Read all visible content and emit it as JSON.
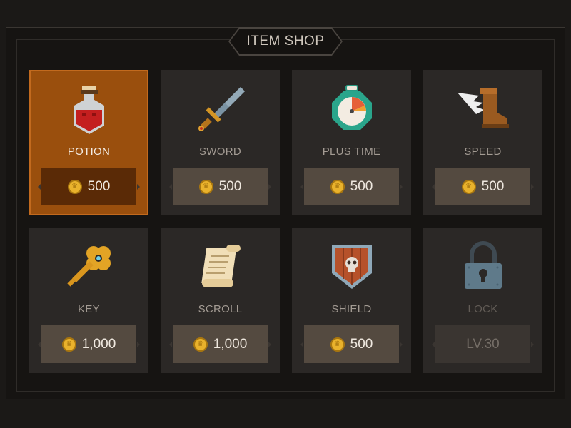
{
  "shop": {
    "title": "ITEM SHOP"
  },
  "items": [
    {
      "label": "POTION",
      "price": "500",
      "selected": true
    },
    {
      "label": "SWORD",
      "price": "500"
    },
    {
      "label": "PLUS TIME",
      "price": "500"
    },
    {
      "label": "SPEED",
      "price": "500"
    },
    {
      "label": "KEY",
      "price": "1,000"
    },
    {
      "label": "SCROLL",
      "price": "1,000"
    },
    {
      "label": "SHIELD",
      "price": "500"
    },
    {
      "label": "LOCK",
      "price": "LV.30",
      "locked": true
    }
  ],
  "icons": [
    "potion-icon",
    "sword-icon",
    "stopwatch-icon",
    "winged-boot-icon",
    "key-icon",
    "scroll-icon",
    "shield-icon",
    "padlock-icon"
  ],
  "colors": {
    "accent": "#9a4f0d",
    "coin": "#e9b22c",
    "panel": "#2b2826"
  }
}
